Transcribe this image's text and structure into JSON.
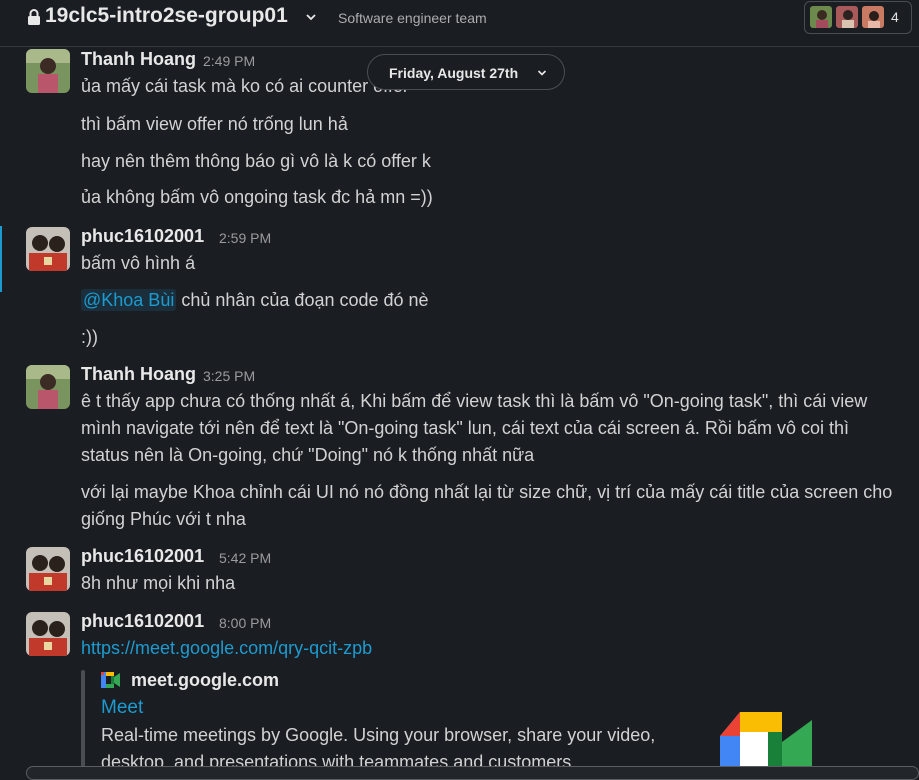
{
  "header": {
    "channel_name": "19clc5-intro2se-group01",
    "topic": "Software engineer team",
    "member_count": "4",
    "icons": [
      "lock-icon",
      "chevron-down-icon"
    ]
  },
  "date_divider": {
    "label": "Friday, August 27th"
  },
  "messages": [
    {
      "author": "Thanh Hoang",
      "time": "2:49 PM",
      "lines": [
        "ủa mấy cái task mà ko có ai counter offer",
        "thì bấm view offer nó trống lun hả",
        "hay nên thêm thông báo gì vô là k có offer k",
        "ủa không bấm vô ongoing task đc hả mn =))"
      ]
    },
    {
      "author": "phuc16102001",
      "time": "2:59 PM",
      "lines": [
        "bấm vô hình á",
        "chủ nhân của đoạn code đó nè",
        ":))"
      ],
      "mention": "@Khoa Bùi"
    },
    {
      "author": "Thanh Hoang",
      "time": "3:25 PM",
      "lines": [
        "ê t thấy app chưa có thống nhất á, Khi bấm để view task thì là bấm vô \"On-going task\", thì cái view",
        "mình navigate tới nên để text là \"On-going task\" lun, cái text của cái screen á. Rồi bấm vô coi thì",
        "status nên là On-going, chứ \"Doing\" nó k thống nhất nữa",
        "với lại maybe Khoa chỉnh cái UI nó nó đồng nhất lại từ size chữ, vị trí của mấy cái title của screen cho",
        "giống Phúc với t nha"
      ]
    },
    {
      "author": "phuc16102001",
      "time": "5:42 PM",
      "lines": [
        "8h như mọi khi nha"
      ]
    },
    {
      "author": "phuc16102001",
      "time": "8:00 PM",
      "lines": [
        "https://meet.google.com/qry-qcit-zpb"
      ],
      "unfurl": {
        "site": "meet.google.com",
        "title": "Meet",
        "description_lines": [
          "Real-time meetings by Google. Using your browser, share your video,",
          "desktop, and presentations with teammates and customers."
        ]
      }
    }
  ],
  "colors": {
    "background": "#1a1d21",
    "link": "#1d9bd1",
    "text": "#d1d2d3"
  }
}
